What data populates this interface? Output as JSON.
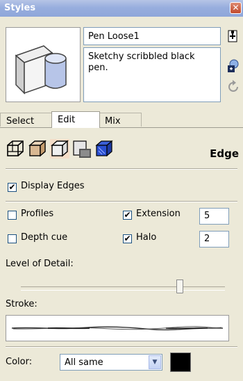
{
  "window": {
    "title": "Styles",
    "close": "✕"
  },
  "style": {
    "name": "Pen Loose1",
    "description": "Sketchy scribbled black pen."
  },
  "tabs": [
    {
      "label": "Select",
      "active": false
    },
    {
      "label": "Edit",
      "active": true
    },
    {
      "label": "Mix",
      "active": false
    }
  ],
  "edge_toolbar": {
    "section_label": "Edge",
    "icons": [
      "edge-settings-icon",
      "face-settings-icon",
      "background-settings-icon",
      "watermark-settings-icon",
      "modeling-settings-icon"
    ]
  },
  "edge_settings": {
    "display_edges": {
      "label": "Display Edges",
      "checked": true
    },
    "profiles": {
      "label": "Profiles",
      "checked": false
    },
    "depth_cue": {
      "label": "Depth cue",
      "checked": false
    },
    "extension": {
      "label": "Extension",
      "checked": true,
      "value": "5"
    },
    "halo": {
      "label": "Halo",
      "checked": true,
      "value": "2"
    },
    "level_of_detail": {
      "label": "Level of Detail:",
      "value_fraction": 0.78
    },
    "stroke": {
      "label": "Stroke:"
    },
    "color": {
      "label": "Color:",
      "selected": "All same",
      "swatch": "#000000"
    }
  }
}
